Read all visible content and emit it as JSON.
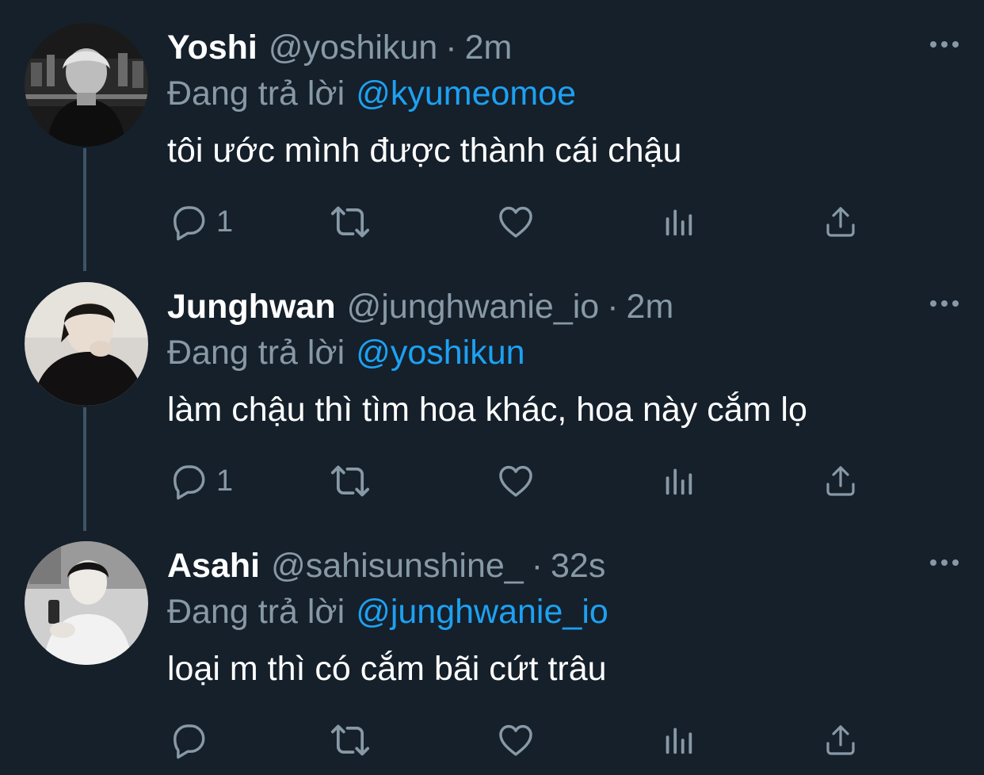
{
  "colors": {
    "background": "#15202b",
    "text_primary": "#ffffff",
    "text_secondary": "#8899a6",
    "mention": "#1da1f2",
    "thread_line": "#3d5466"
  },
  "tweets": [
    {
      "display_name": "Yoshi",
      "handle": "@yoshikun",
      "separator": "·",
      "time": "2m",
      "reply_label": "Đang trả lời",
      "reply_to": "@kyumeomoe",
      "text": "tôi ước mình được thành cái chậu",
      "reply_count": "1",
      "icons": [
        "reply-icon",
        "retweet-icon",
        "like-icon",
        "analytics-icon",
        "share-icon",
        "more-icon"
      ]
    },
    {
      "display_name": "Junghwan",
      "handle": "@junghwanie_io",
      "separator": "·",
      "time": "2m",
      "reply_label": "Đang trả lời",
      "reply_to": "@yoshikun",
      "text": "làm chậu thì tìm hoa khác, hoa này cắm lọ",
      "reply_count": "1",
      "icons": [
        "reply-icon",
        "retweet-icon",
        "like-icon",
        "analytics-icon",
        "share-icon",
        "more-icon"
      ]
    },
    {
      "display_name": "Asahi",
      "handle": "@sahisunshine_",
      "separator": "·",
      "time": "32s",
      "reply_label": "Đang trả lời",
      "reply_to": "@junghwanie_io",
      "text": "loại m thì có cắm bãi cứt trâu",
      "reply_count": "",
      "icons": [
        "reply-icon",
        "retweet-icon",
        "like-icon",
        "analytics-icon",
        "share-icon",
        "more-icon"
      ]
    }
  ]
}
